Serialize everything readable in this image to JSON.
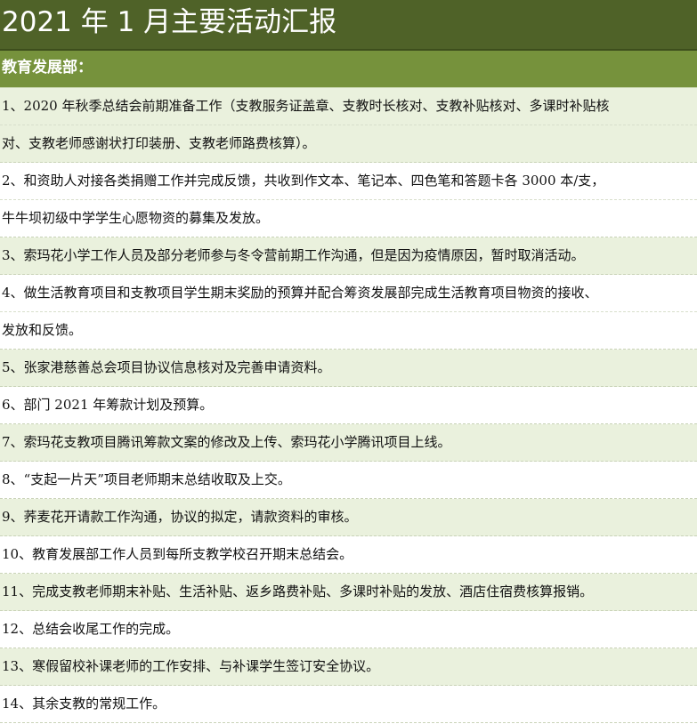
{
  "title": "2021 年 1 月主要活动汇报",
  "section": "教育发展部：",
  "items": [
    {
      "lines": [
        "1、2020 年秋季总结会前期准备工作（支教服务证盖章、支教时长核对、支教补贴核对、多课时补贴核",
        "对、支教老师感谢状打印装册、支教老师路费核算）。"
      ]
    },
    {
      "lines": [
        "2、和资助人对接各类捐赠工作并完成反馈，共收到作文本、笔记本、四色笔和答题卡各 3000 本/支，",
        "牛牛坝初级中学学生心愿物资的募集及发放。"
      ]
    },
    {
      "lines": [
        "3、索玛花小学工作人员及部分老师参与冬令营前期工作沟通，但是因为疫情原因，暂时取消活动。"
      ]
    },
    {
      "lines": [
        "4、做生活教育项目和支教项目学生期末奖励的预算并配合筹资发展部完成生活教育项目物资的接收、",
        "发放和反馈。"
      ]
    },
    {
      "lines": [
        "5、张家港慈善总会项目协议信息核对及完善申请资料。"
      ]
    },
    {
      "lines": [
        "6、部门 2021 年筹款计划及预算。"
      ]
    },
    {
      "lines": [
        "7、索玛花支教项目腾讯筹款文案的修改及上传、索玛花小学腾讯项目上线。"
      ]
    },
    {
      "lines": [
        "8、“支起一片天”项目老师期末总结收取及上交。"
      ]
    },
    {
      "lines": [
        "9、荞麦花开请款工作沟通，协议的拟定，请款资料的审核。"
      ]
    },
    {
      "lines": [
        "10、教育发展部工作人员到每所支教学校召开期末总结会。"
      ]
    },
    {
      "lines": [
        "11、完成支教老师期末补贴、生活补贴、返乡路费补贴、多课时补贴的发放、酒店住宿费核算报销。"
      ]
    },
    {
      "lines": [
        "12、总结会收尾工作的完成。"
      ]
    },
    {
      "lines": [
        "13、寒假留校补课老师的工作安排、与补课学生签订安全协议。"
      ]
    },
    {
      "lines": [
        "14、其余支教的常规工作。"
      ]
    }
  ],
  "colors": {
    "title_bg": "#4f6228",
    "section_bg": "#76923c",
    "row_green": "#eaf1dd",
    "row_white": "#ffffff"
  }
}
